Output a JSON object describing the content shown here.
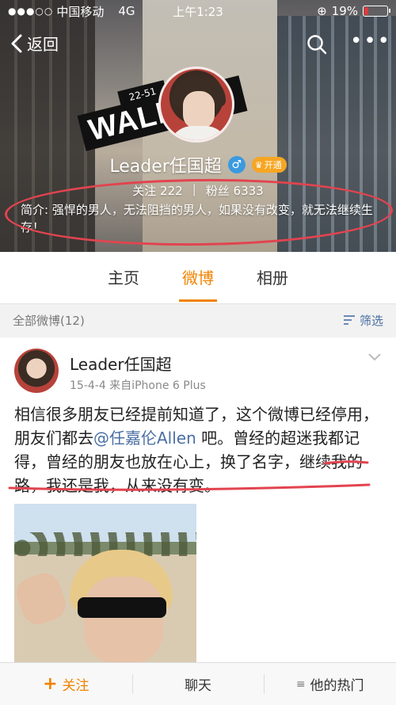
{
  "status_bar": {
    "signal": "●●●○○",
    "carrier": "中国移动",
    "network": "4G",
    "time": "上午1:23",
    "battery": "19%",
    "battery_level": 0.19
  },
  "nav": {
    "back_label": "返回"
  },
  "banner": {
    "street_sign": "WALL",
    "street_number": "22-51"
  },
  "profile": {
    "username": "Leader任国超",
    "gender_symbol": "♂",
    "vip_label": "开通",
    "following_label": "关注",
    "following_count": "222",
    "followers_label": "粉丝",
    "followers_count": "6333",
    "intro": "简介: 强悍的男人，无法阻挡的男人，如果没有改变，就无法继续生存！"
  },
  "tabs": [
    {
      "label": "主页",
      "active": false
    },
    {
      "label": "微博",
      "active": true
    },
    {
      "label": "相册",
      "active": false
    }
  ],
  "filter_bar": {
    "all_posts": "全部微博(12)",
    "filter_label": "筛选"
  },
  "post": {
    "author": "Leader任国超",
    "meta": "15-4-4  来自iPhone 6 Plus",
    "text_before": "相信很多朋友已经提前知道了，这个微博已经停用，朋友们都去",
    "mention": "@任嘉伦Allen",
    "text_after": " 吧。曾经的超迷我都记得，曾经的朋友也放在心上，换了名字，继续我的路，我还是我，从来没有变。"
  },
  "bottom_bar": {
    "follow": "关注",
    "chat": "聊天",
    "hot": "他的热门"
  },
  "colors": {
    "accent": "#f08300",
    "link": "#4a6fa3",
    "annotation_red": "#e2444f"
  }
}
